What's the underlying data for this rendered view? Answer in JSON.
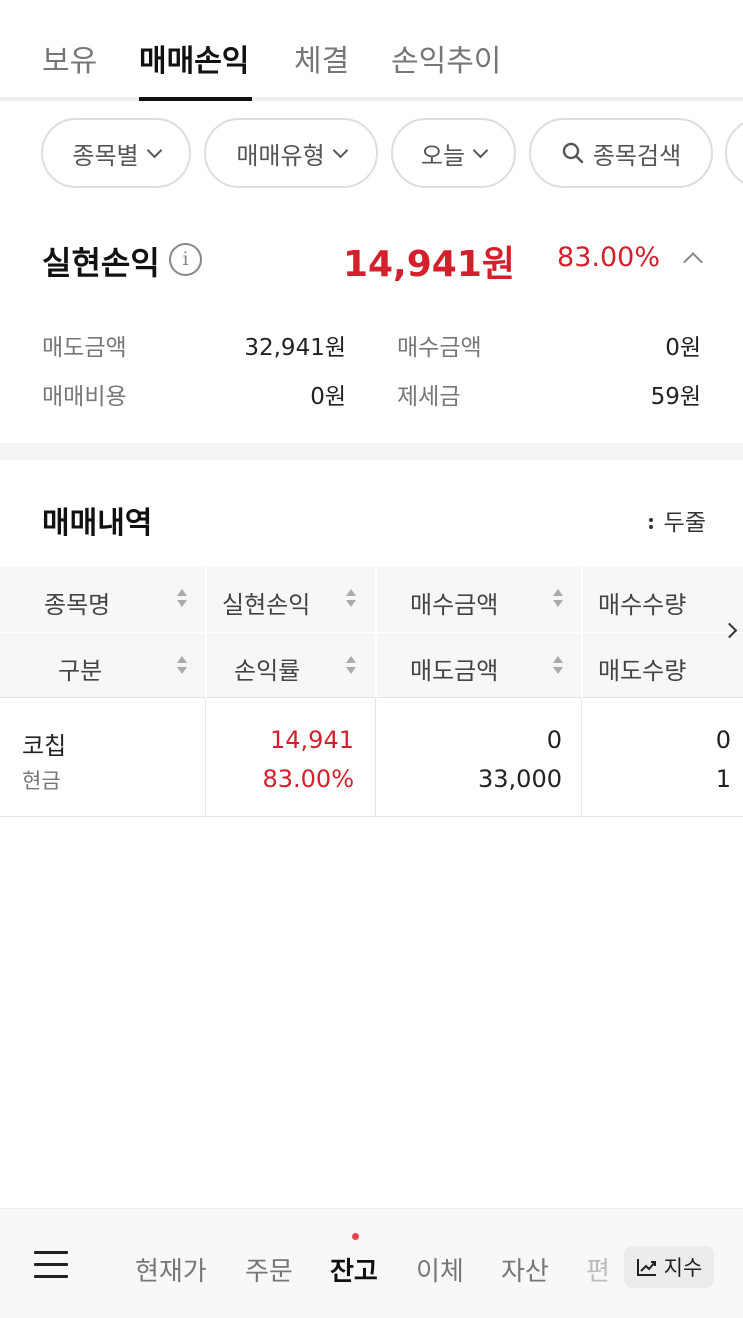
{
  "tabs": [
    "보유",
    "매매손익",
    "체결",
    "손익추이"
  ],
  "filters": {
    "by_stock": "종목별",
    "trade_type": "매매유형",
    "period": "오늘",
    "search": "종목검색"
  },
  "realized_pl": {
    "title": "실현손익",
    "amount": "14,941원",
    "rate": "83.00%"
  },
  "summary": {
    "sell_amount_label": "매도금액",
    "sell_amount": "32,941원",
    "buy_amount_label": "매수금액",
    "buy_amount": "0원",
    "trade_cost_label": "매매비용",
    "trade_cost": "0원",
    "tax_label": "제세금",
    "tax": "59원"
  },
  "history": {
    "title": "매매내역",
    "row_toggle": "두줄",
    "headers_row1": [
      "종목명",
      "실현손익",
      "매수금액",
      "매수수량"
    ],
    "headers_row2": [
      "구분",
      "손익률",
      "매도금액",
      "매도수량"
    ],
    "rows": [
      {
        "name": "코칩",
        "type": "현금",
        "pl": "14,941",
        "pl_rate": "83.00%",
        "buy_amount": "0",
        "sell_amount": "33,000",
        "buy_qty": "0",
        "sell_qty": "1"
      }
    ]
  },
  "bottom_nav": {
    "items": [
      "현재가",
      "주문",
      "잔고",
      "이체",
      "자산",
      "편"
    ],
    "active": "잔고",
    "index_button": "지수"
  },
  "colors": {
    "profit_red": "#d4202c",
    "active_text": "#111111",
    "notification_dot": "#e8424e"
  }
}
